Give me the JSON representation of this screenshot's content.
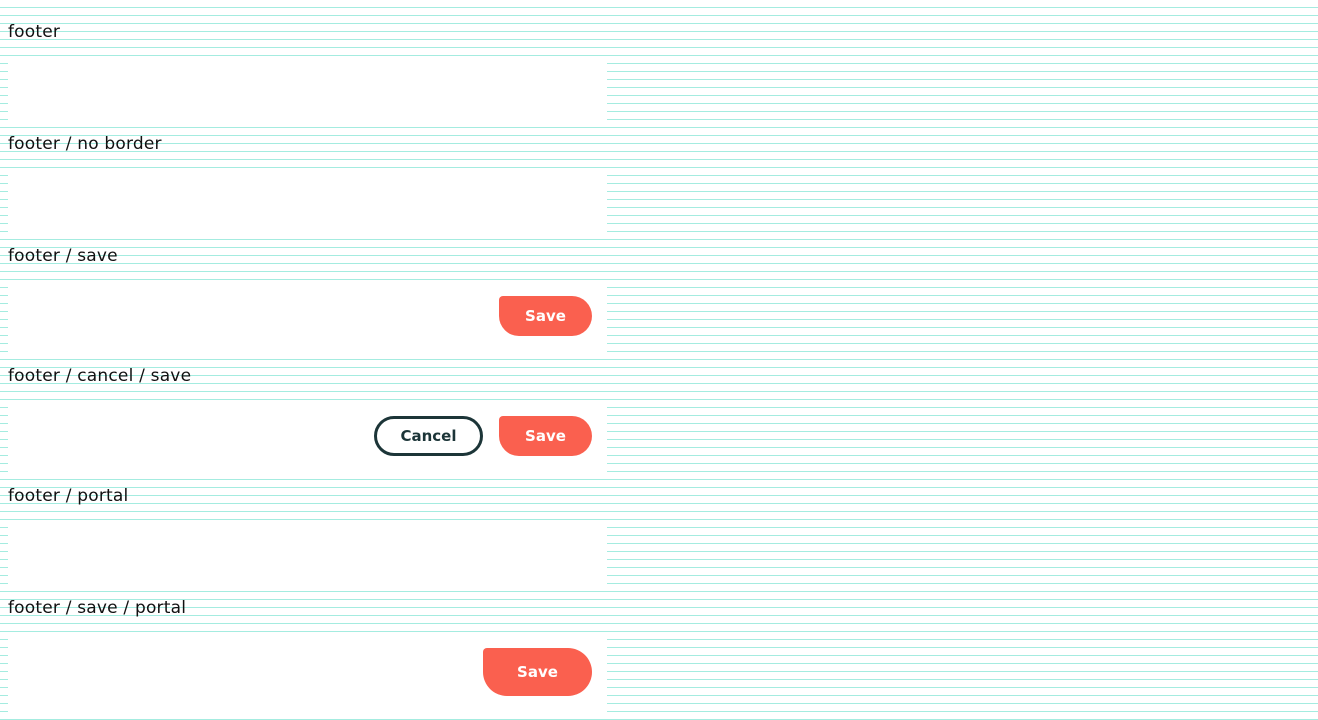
{
  "sections": [
    {
      "label": "footer"
    },
    {
      "label": "footer / no border"
    },
    {
      "label": "footer / save",
      "save_label": "Save"
    },
    {
      "label": "footer / cancel / save",
      "cancel_label": "Cancel",
      "save_label": "Save"
    },
    {
      "label": "footer / portal"
    },
    {
      "label": "footer / save / portal",
      "save_label": "Save"
    }
  ],
  "colors": {
    "background": "#ffffff",
    "stripe": "#a4ece0",
    "save_button": "#fa604f",
    "cancel_border": "#1c3538",
    "label_text": "#111111"
  }
}
